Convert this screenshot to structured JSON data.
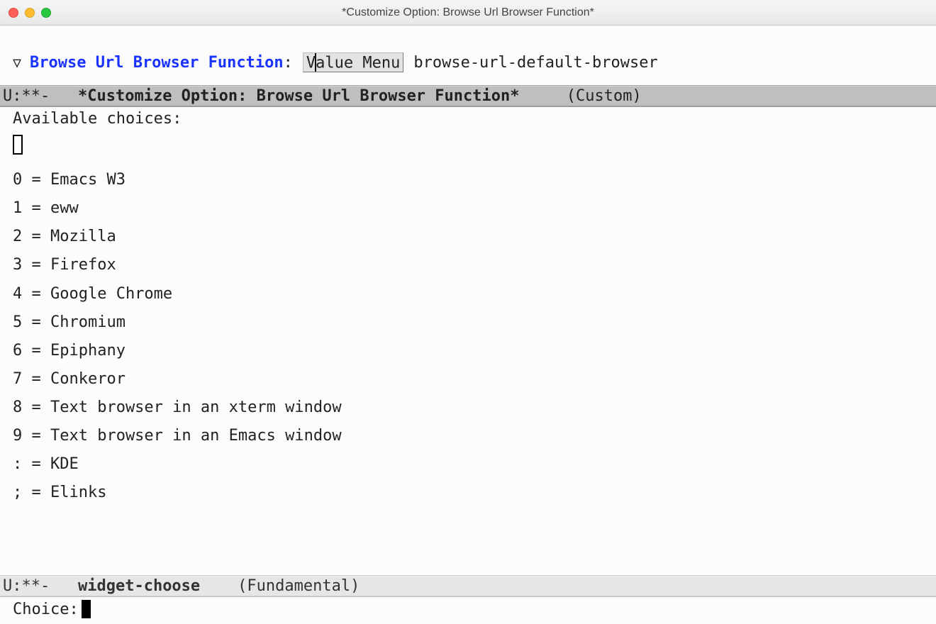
{
  "window": {
    "title": "*Customize Option: Browse Url Browser Function*"
  },
  "customize": {
    "triangle": "▽",
    "option_name": "Browse Url Browser Function",
    "colon": ":",
    "value_menu_label": "Value Menu",
    "current_value": "browse-url-default-browser"
  },
  "modeline_top": {
    "left": "U:**-",
    "buffer": "*Customize Option: Browse Url Browser Function*",
    "mode": "(Custom)"
  },
  "choices": {
    "header": "Available choices:",
    "items": [
      {
        "key": "0",
        "label": "Emacs W3"
      },
      {
        "key": "1",
        "label": "eww"
      },
      {
        "key": "2",
        "label": "Mozilla"
      },
      {
        "key": "3",
        "label": "Firefox"
      },
      {
        "key": "4",
        "label": "Google Chrome"
      },
      {
        "key": "5",
        "label": "Chromium"
      },
      {
        "key": "6",
        "label": "Epiphany"
      },
      {
        "key": "7",
        "label": "Conkeror"
      },
      {
        "key": "8",
        "label": "Text browser in an xterm window"
      },
      {
        "key": "9",
        "label": "Text browser in an Emacs window"
      },
      {
        "key": ":",
        "label": "KDE"
      },
      {
        "key": ";",
        "label": "Elinks"
      }
    ]
  },
  "modeline_bottom": {
    "left": "U:**-",
    "buffer": "widget-choose",
    "mode": "(Fundamental)"
  },
  "minibuffer": {
    "prompt": "Choice:"
  }
}
